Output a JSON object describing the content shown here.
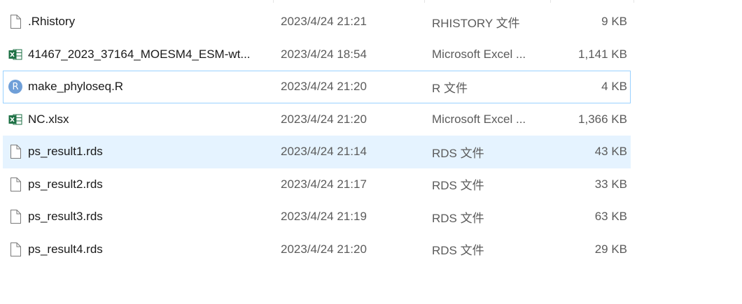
{
  "files": [
    {
      "name": ".Rhistory",
      "date": "2023/4/24 21:21",
      "type": "RHISTORY 文件",
      "size": "9 KB",
      "icon": "blank-file-icon",
      "state": "normal"
    },
    {
      "name": "41467_2023_37164_MOESM4_ESM-wt...",
      "date": "2023/4/24 18:54",
      "type": "Microsoft Excel ...",
      "size": "1,141 KB",
      "icon": "excel-file-icon",
      "state": "normal"
    },
    {
      "name": "make_phyloseq.R",
      "date": "2023/4/24 21:20",
      "type": "R 文件",
      "size": "4 KB",
      "icon": "r-script-icon",
      "icon_letter": "R",
      "state": "focused"
    },
    {
      "name": "NC.xlsx",
      "date": "2023/4/24 21:20",
      "type": "Microsoft Excel ...",
      "size": "1,366 KB",
      "icon": "excel-file-icon",
      "state": "normal"
    },
    {
      "name": "ps_result1.rds",
      "date": "2023/4/24 21:14",
      "type": "RDS 文件",
      "size": "43 KB",
      "icon": "blank-file-icon",
      "state": "hover"
    },
    {
      "name": "ps_result2.rds",
      "date": "2023/4/24 21:17",
      "type": "RDS 文件",
      "size": "33 KB",
      "icon": "blank-file-icon",
      "state": "normal"
    },
    {
      "name": "ps_result3.rds",
      "date": "2023/4/24 21:19",
      "type": "RDS 文件",
      "size": "63 KB",
      "icon": "blank-file-icon",
      "state": "normal"
    },
    {
      "name": "ps_result4.rds",
      "date": "2023/4/24 21:20",
      "type": "RDS 文件",
      "size": "29 KB",
      "icon": "blank-file-icon",
      "state": "normal"
    }
  ],
  "colors": {
    "hover_bg": "#e5f3ff",
    "focus_border": "#99d1ff",
    "excel_green": "#1e7145",
    "r_blue": "#6f9fd8",
    "secondary_text": "#5b5b5b"
  }
}
